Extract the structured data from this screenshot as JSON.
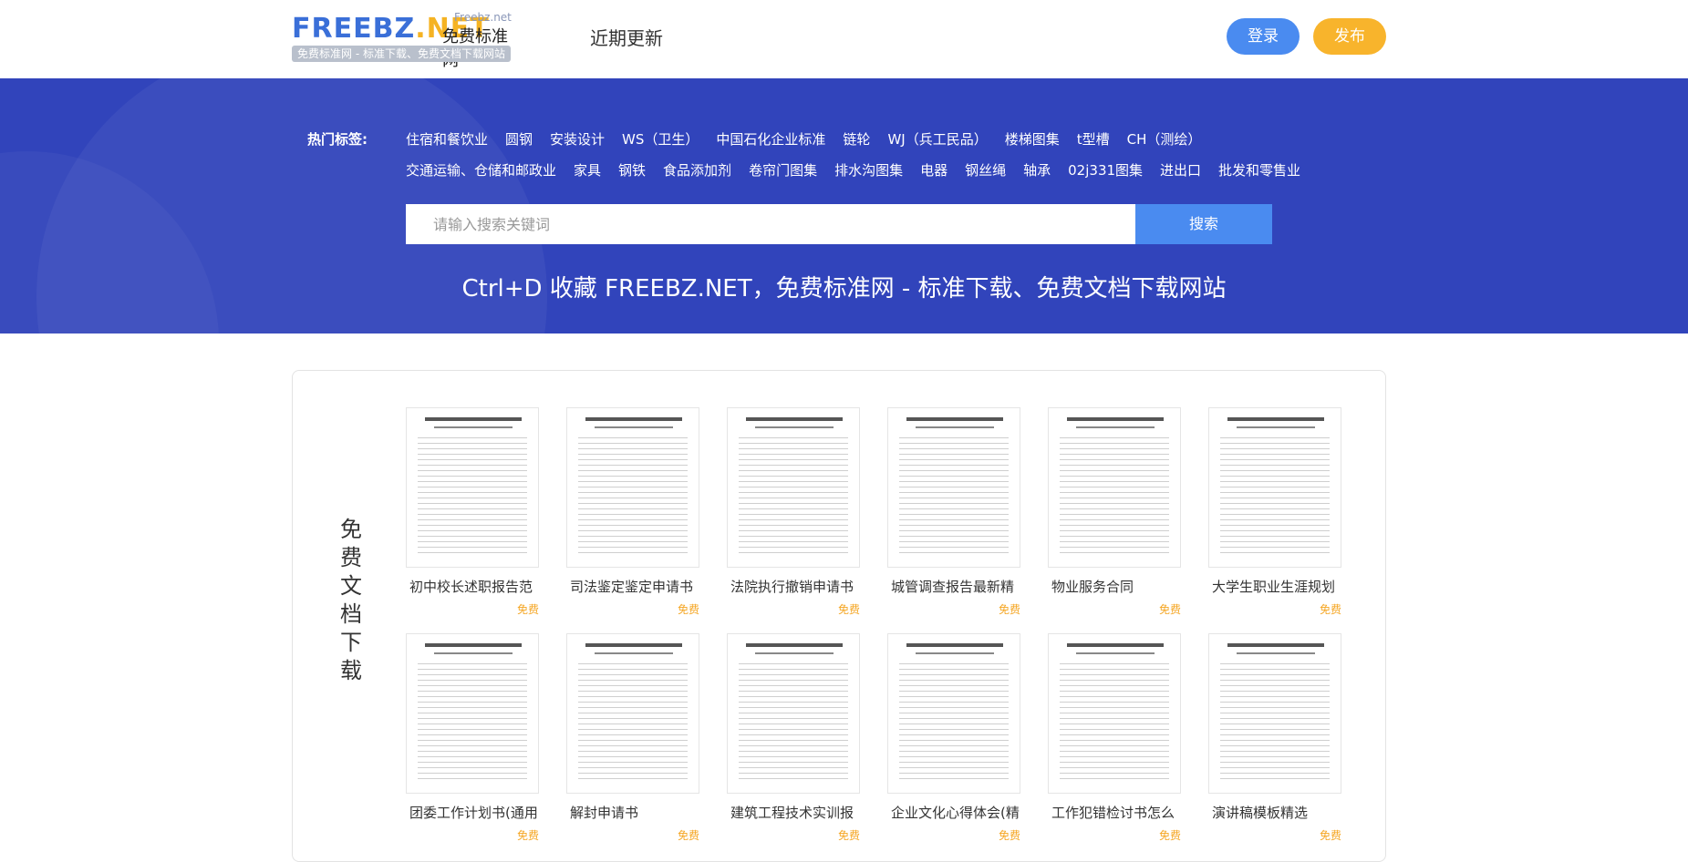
{
  "header": {
    "logo_main": "FREEBZ.NET",
    "logo_en": "Freebz.net",
    "logo_cn": "免费标准网",
    "logo_tagline": "免费标准网 - 标准下载、免费文档下载网站",
    "nav_recent": "近期更新",
    "login": "登录",
    "publish": "发布"
  },
  "banner": {
    "tags_label": "热门标签:",
    "tags_row1": [
      "住宿和餐饮业",
      "圆钢",
      "安装设计",
      "WS（卫生）",
      "中国石化企业标准",
      "链轮",
      "WJ（兵工民品）",
      "楼梯图集",
      "t型槽",
      "CH（测绘）"
    ],
    "tags_row2": [
      "交通运输、仓储和邮政业",
      "家具",
      "钢铁",
      "食品添加剂",
      "卷帘门图集",
      "排水沟图集",
      "电器",
      "钢丝绳",
      "轴承",
      "02j331图集",
      "进出口",
      "批发和零售业"
    ],
    "search_placeholder": "请输入搜索关键词",
    "search_button": "搜索",
    "slogan": "Ctrl+D 收藏 FREEBZ.NET，免费标准网 - 标准下载、免费文档下载网站"
  },
  "section": {
    "title": "免费文档下载",
    "docs": [
      {
        "title": "初中校长述职报告范",
        "badge": "免费"
      },
      {
        "title": "司法鉴定鉴定申请书",
        "badge": "免费"
      },
      {
        "title": "法院执行撤销申请书",
        "badge": "免费"
      },
      {
        "title": "城管调查报告最新精",
        "badge": "免费"
      },
      {
        "title": "物业服务合同",
        "badge": "免费"
      },
      {
        "title": "大学生职业生涯规划",
        "badge": "免费"
      },
      {
        "title": "团委工作计划书(通用)",
        "badge": "免费"
      },
      {
        "title": "解封申请书",
        "badge": "免费"
      },
      {
        "title": "建筑工程技术实训报",
        "badge": "免费"
      },
      {
        "title": "企业文化心得体会(精",
        "badge": "免费"
      },
      {
        "title": "工作犯错检讨书怎么",
        "badge": "免费"
      },
      {
        "title": "演讲稿模板精选",
        "badge": "免费"
      }
    ]
  },
  "colors": {
    "brand_blue": "#3144bb",
    "accent_blue": "#4a8bf0",
    "accent_orange": "#f8b42c",
    "free_badge": "#f5a623"
  }
}
